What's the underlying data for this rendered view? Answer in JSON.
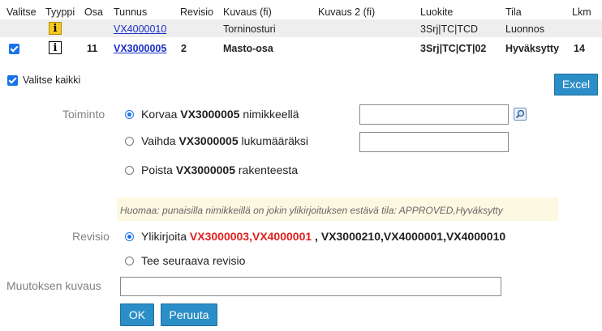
{
  "table": {
    "headers": {
      "select": "Valitse",
      "type": "Tyyppi",
      "part": "Osa",
      "code": "Tunnus",
      "revision": "Revisio",
      "desc": "Kuvaus (fi)",
      "desc2": "Kuvaus 2 (fi)",
      "class": "Luokite",
      "state": "Tila",
      "count": "Lkm"
    },
    "rows": [
      {
        "selected": false,
        "type_icon": "info-icon-yellow",
        "part": "",
        "code": "VX4000010",
        "revision": "",
        "desc": "Torninosturi",
        "desc2": "",
        "class": "3Srj|TC|TCD",
        "state": "Luonnos",
        "count": ""
      },
      {
        "selected": true,
        "type_icon": "info-icon-white",
        "part": "11",
        "code": "VX3000005",
        "revision": "2",
        "desc": "Masto-osa",
        "desc2": "",
        "class": "3Srj|TC|CT|02",
        "state": "Hyväksytty",
        "count": "14"
      }
    ]
  },
  "select_all": {
    "label": "Valitse kaikki",
    "checked": true
  },
  "excel_button": "Excel",
  "action": {
    "label": "Toiminto",
    "replace": {
      "pre": "Korvaa ",
      "code": "VX3000005",
      "post": " nimikkeellä",
      "selected": true
    },
    "change": {
      "pre": "Vaihda ",
      "code": "VX3000005",
      "post": " lukumääräksi",
      "selected": false
    },
    "remove": {
      "pre": "Poista ",
      "code": "VX3000005",
      "post": " rakenteesta",
      "selected": false
    },
    "replace_input_value": "",
    "count_input_value": ""
  },
  "note": "Huomaa: punaisilla nimikkeillä on jokin ylikirjoituksen estävä tila: APPROVED,Hyväksytty",
  "revision": {
    "label": "Revisio",
    "overwrite": {
      "pre": "Ylikirjoita ",
      "red_items": "VX3000003,VX4000001",
      "rest": " , VX3000210,VX4000001,VX4000010",
      "selected": true
    },
    "next": {
      "label": "Tee seuraava revisio",
      "selected": false
    }
  },
  "change_desc": {
    "label": "Muutoksen kuvaus",
    "value": ""
  },
  "buttons": {
    "ok": "OK",
    "cancel": "Peruuta"
  },
  "colors": {
    "button": "#2b8ec6",
    "link": "#1a2fc8",
    "red": "#e02020",
    "note_bg": "#fdf8e1",
    "row_bg": "#eeeeee"
  }
}
